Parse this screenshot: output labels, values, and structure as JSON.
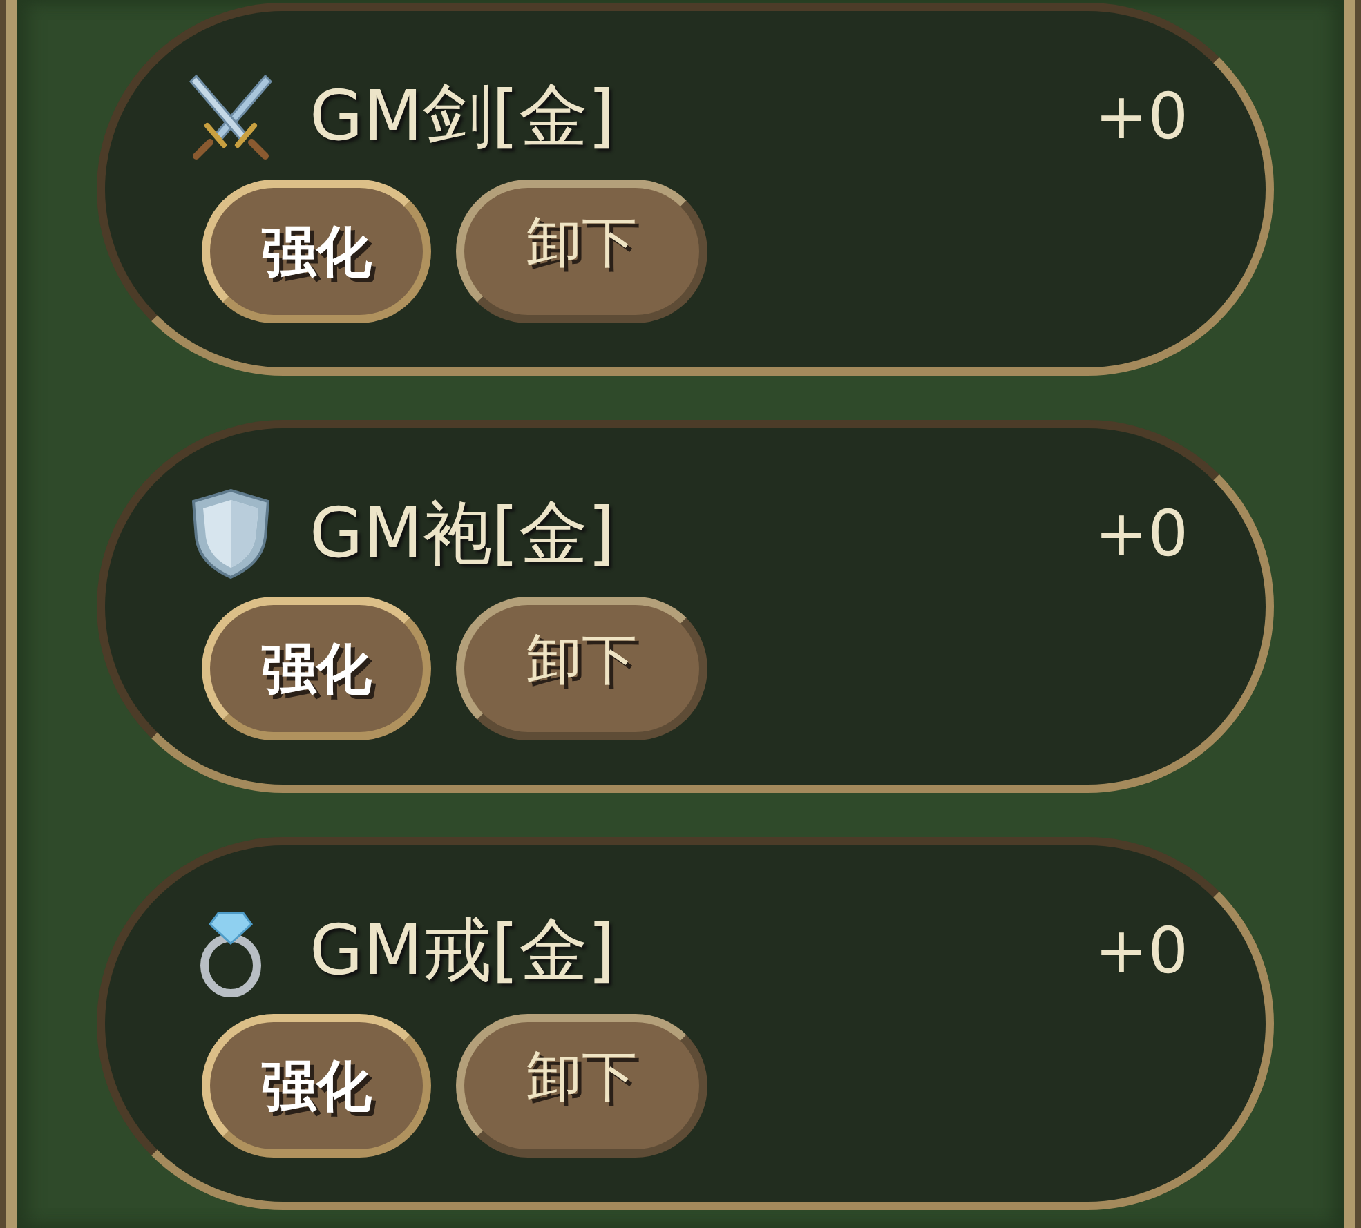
{
  "items": [
    {
      "kind": "sword",
      "name": "GM剑[金]",
      "level_text": "+0",
      "buttons": [
        {
          "label": "强化",
          "kind": "primary"
        },
        {
          "label": "卸下",
          "kind": "secondary"
        }
      ]
    },
    {
      "kind": "armor",
      "name": "GM袍[金]",
      "level_text": "+0",
      "buttons": [
        {
          "label": "强化",
          "kind": "primary"
        },
        {
          "label": "卸下",
          "kind": "secondary"
        }
      ]
    },
    {
      "kind": "ring",
      "name": "GM戒[金]",
      "level_text": "+0",
      "buttons": [
        {
          "label": "强化",
          "kind": "primary"
        },
        {
          "label": "卸下",
          "kind": "secondary"
        }
      ]
    }
  ]
}
